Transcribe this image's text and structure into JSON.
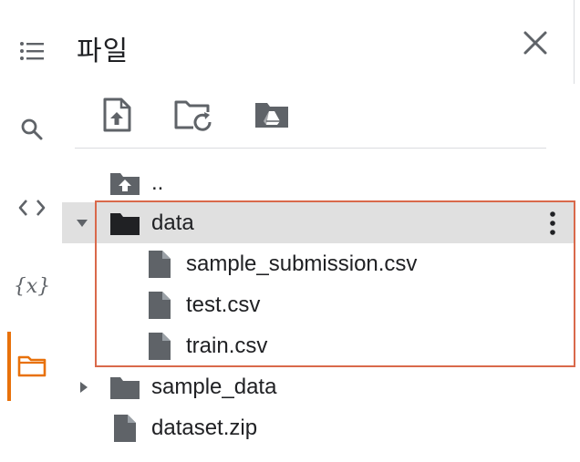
{
  "panel": {
    "title": "파일"
  },
  "rail": {
    "items": [
      {
        "name": "table-of-contents-icon"
      },
      {
        "name": "search-icon"
      },
      {
        "name": "code-snippets-icon"
      },
      {
        "name": "variables-icon",
        "text": "{x}"
      },
      {
        "name": "files-icon",
        "active": true
      }
    ],
    "active_color": "#e8710a"
  },
  "toolbar": {
    "buttons": [
      {
        "name": "upload-file-icon"
      },
      {
        "name": "refresh-folder-icon"
      },
      {
        "name": "mount-drive-icon"
      }
    ]
  },
  "tree": {
    "parent_label": "..",
    "items": [
      {
        "label": "data",
        "type": "folder",
        "expanded": true,
        "selected": true
      },
      {
        "label": "sample_submission.csv",
        "type": "file"
      },
      {
        "label": "test.csv",
        "type": "file"
      },
      {
        "label": "train.csv",
        "type": "file"
      },
      {
        "label": "sample_data",
        "type": "folder",
        "expanded": false
      },
      {
        "label": "dataset.zip",
        "type": "file"
      }
    ]
  },
  "colors": {
    "highlight_border": "#d9694b",
    "selected_row": "#e0e0e0",
    "icon_gray": "#5f6368",
    "folder_dark": "#202124"
  }
}
